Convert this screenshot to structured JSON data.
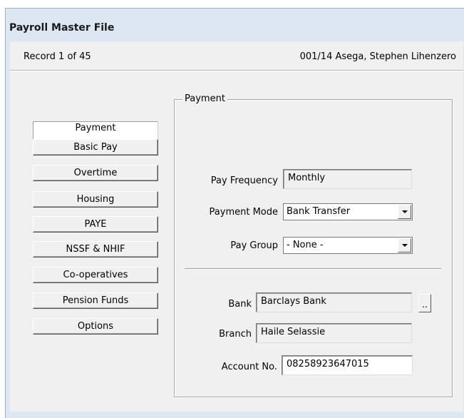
{
  "window": {
    "title": "Payroll Master File"
  },
  "record": {
    "position": "Record 1 of 45",
    "employee": "001/14  Asega, Stephen Lihenzero"
  },
  "nav": {
    "items": [
      {
        "label": "Payment"
      },
      {
        "label": "Basic Pay"
      },
      {
        "label": "Overtime"
      },
      {
        "label": "Housing"
      },
      {
        "label": "PAYE"
      },
      {
        "label": "NSSF & NHIF"
      },
      {
        "label": "Co-operatives"
      },
      {
        "label": "Pension Funds"
      },
      {
        "label": "Options"
      }
    ]
  },
  "payment": {
    "group_label": "Payment",
    "pay_frequency": {
      "label": "Pay Frequency",
      "value": "Monthly"
    },
    "payment_mode": {
      "label": "Payment Mode",
      "value": "Bank Transfer"
    },
    "pay_group": {
      "label": "Pay Group",
      "value": "- None -"
    },
    "bank": {
      "label": "Bank",
      "value": "Barclays Bank",
      "browse_label": ".."
    },
    "branch": {
      "label": "Branch",
      "value": "Haile Selassie"
    },
    "account_no": {
      "label": "Account No.",
      "value": "08258923647015"
    }
  }
}
